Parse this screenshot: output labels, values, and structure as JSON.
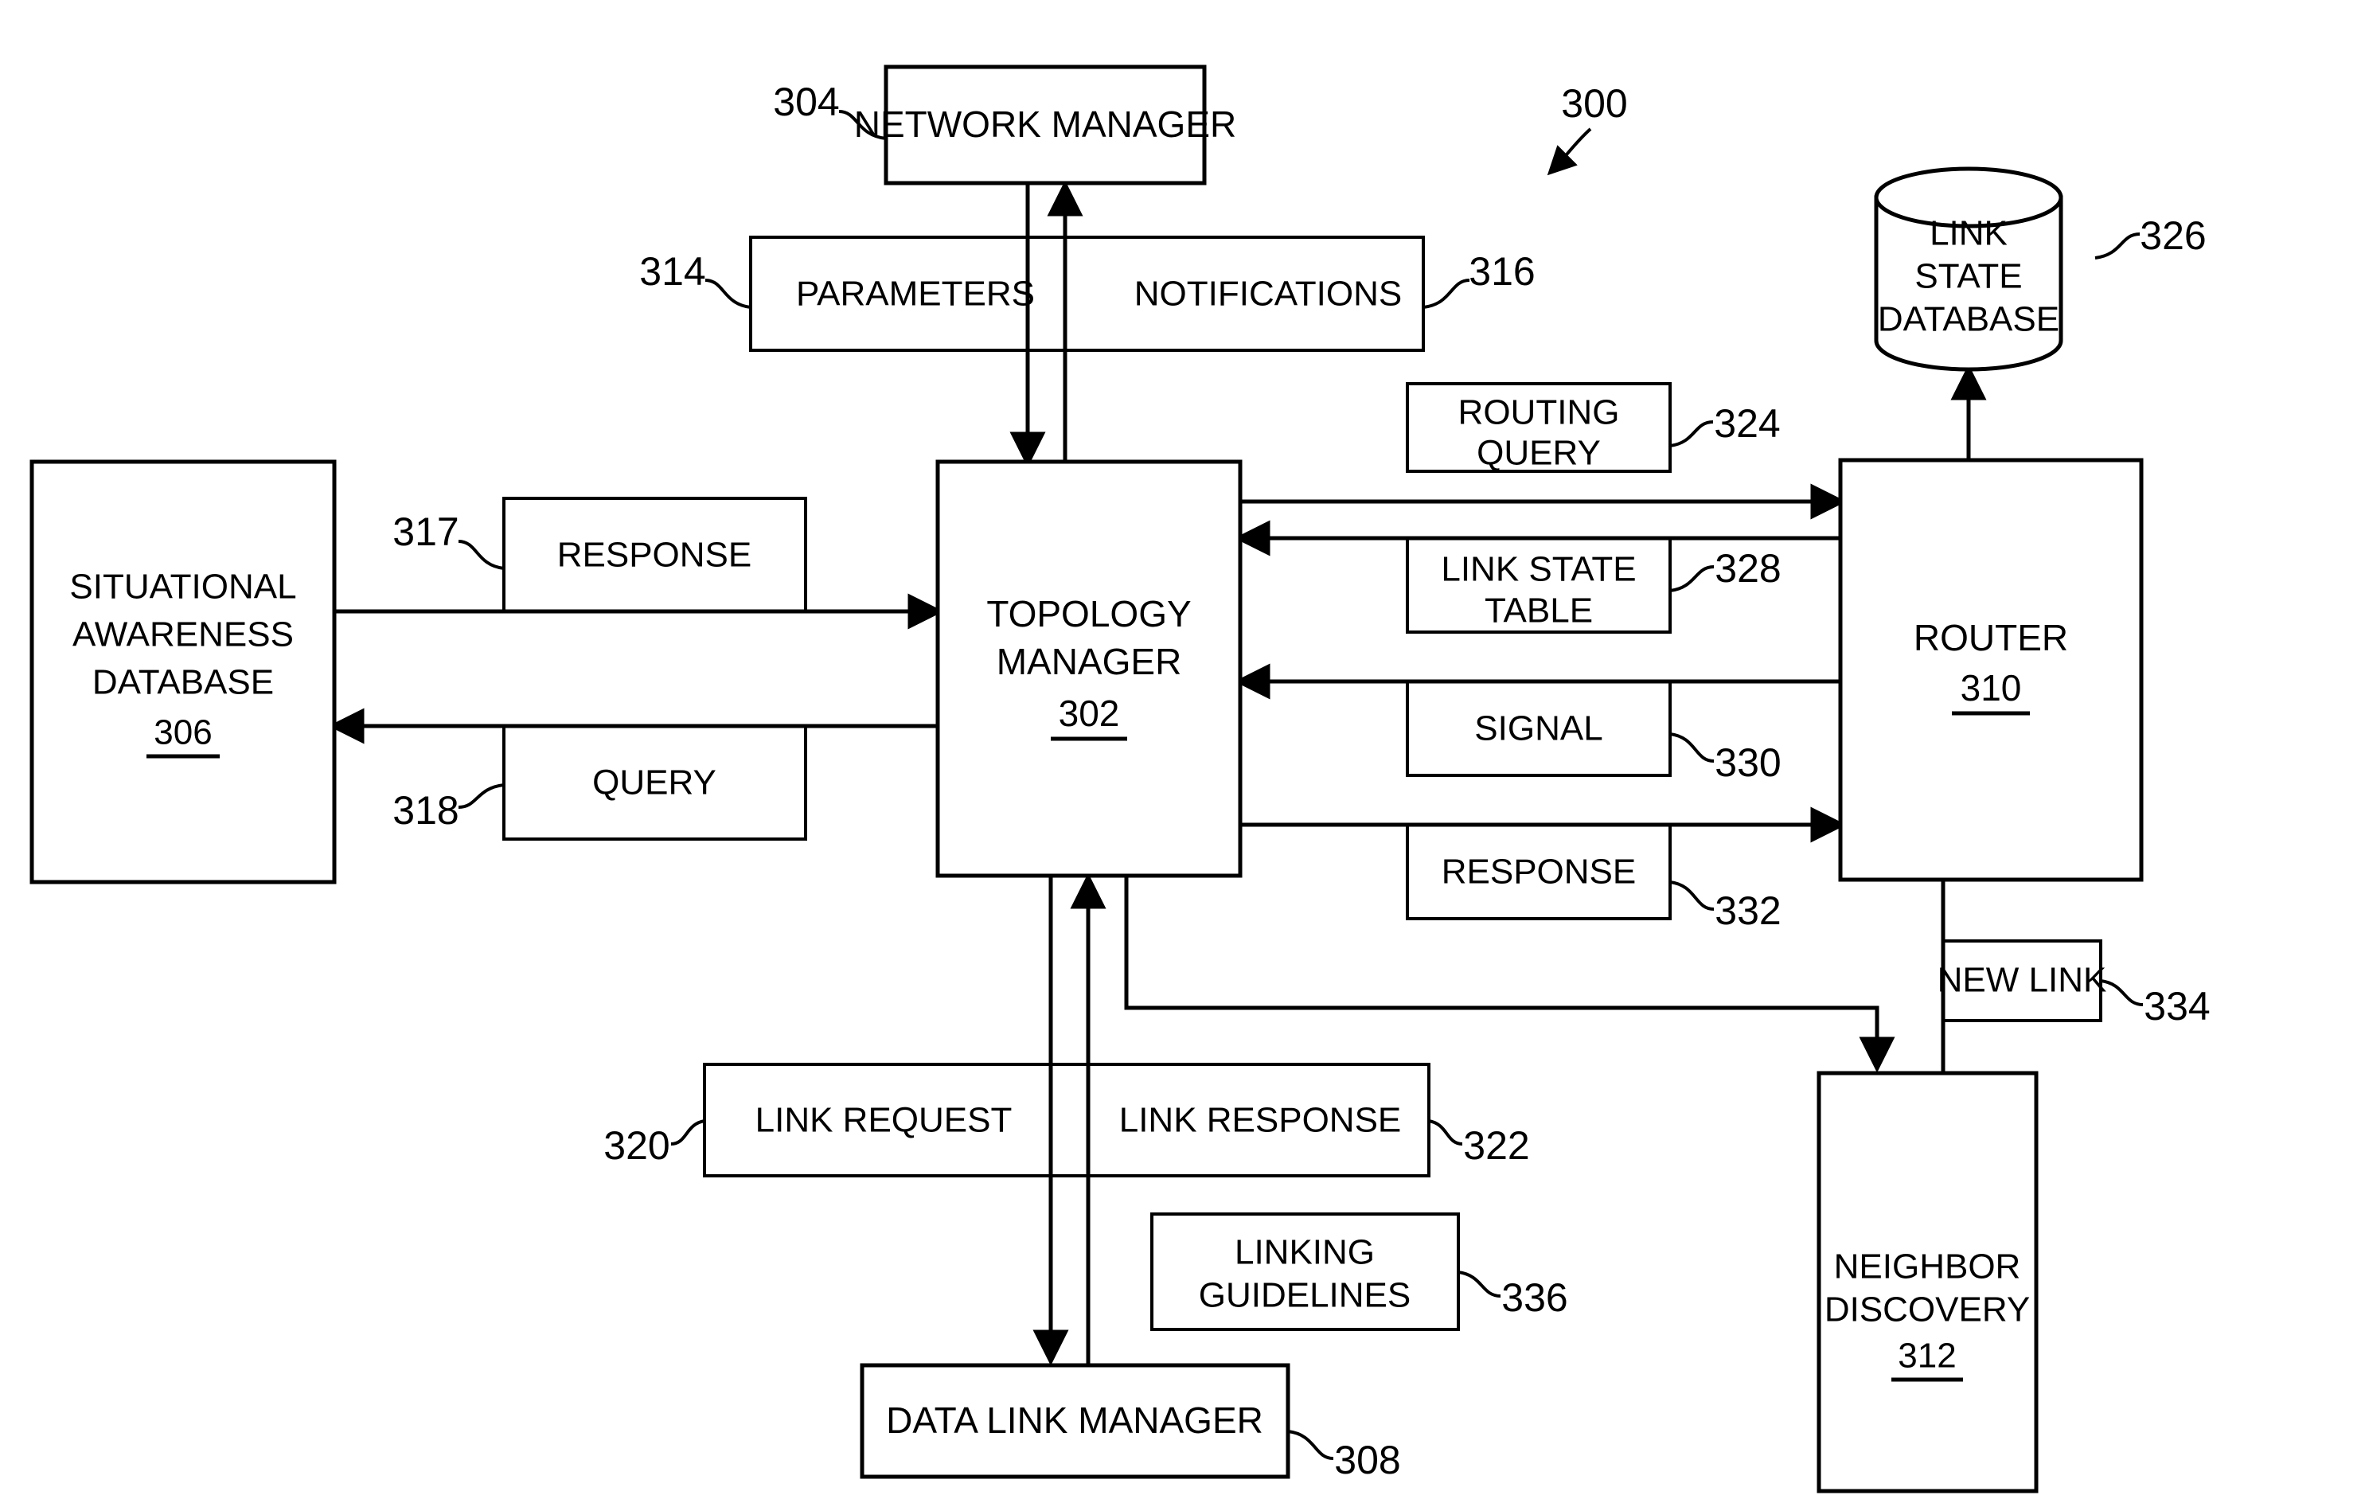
{
  "figure": {
    "reference_label": "300"
  },
  "nodes": {
    "network_manager": {
      "label": "NETWORK MANAGER",
      "ref": "304"
    },
    "situational_awareness_db": {
      "line1": "SITUATIONAL",
      "line2": "AWARENESS",
      "line3": "DATABASE",
      "ref": "306"
    },
    "topology_manager": {
      "line1": "TOPOLOGY",
      "line2": "MANAGER",
      "ref": "302"
    },
    "router": {
      "label": "ROUTER",
      "ref": "310"
    },
    "neighbor_discovery": {
      "line1": "NEIGHBOR",
      "line2": "DISCOVERY",
      "ref": "312"
    },
    "data_link_manager": {
      "label": "DATA LINK MANAGER",
      "ref": "308"
    },
    "link_state_database": {
      "line1": "LINK",
      "line2": "STATE",
      "line3": "DATABASE",
      "ref": "326"
    }
  },
  "labels": {
    "parameters": {
      "text": "PARAMETERS",
      "ref": "314"
    },
    "notifications": {
      "text": "NOTIFICATIONS",
      "ref": "316"
    },
    "response_left": {
      "text": "RESPONSE",
      "ref": "317"
    },
    "query_left": {
      "text": "QUERY",
      "ref": "318"
    },
    "routing_query": {
      "line1": "ROUTING",
      "line2": "QUERY",
      "ref": "324"
    },
    "link_state_table": {
      "line1": "LINK STATE",
      "line2": "TABLE",
      "ref": "328"
    },
    "signal": {
      "text": "SIGNAL",
      "ref": "330"
    },
    "response_right": {
      "text": "RESPONSE",
      "ref": "332"
    },
    "link_request": {
      "text": "LINK REQUEST",
      "ref": "320"
    },
    "link_response": {
      "text": "LINK RESPONSE",
      "ref": "322"
    },
    "linking_guidelines": {
      "line1": "LINKING",
      "line2": "GUIDELINES",
      "ref": "336"
    },
    "new_link": {
      "text": "NEW LINK",
      "ref": "334"
    }
  }
}
